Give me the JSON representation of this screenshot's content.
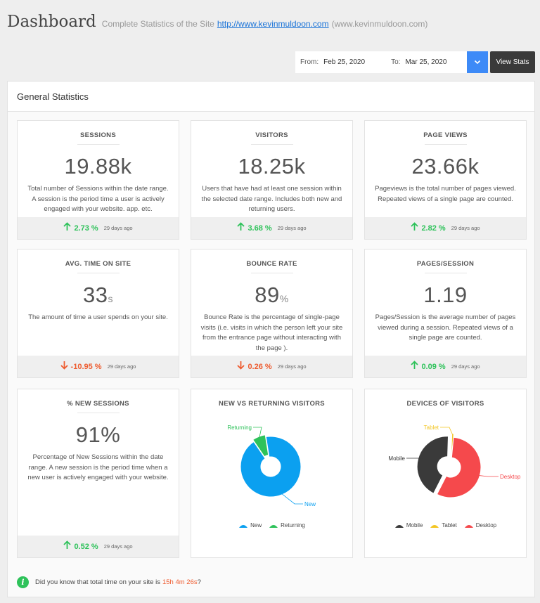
{
  "header": {
    "title": "Dashboard",
    "subtitle": "Complete Statistics of the Site",
    "link": "http://www.kevinmuldoon.com",
    "domain": "(www.kevinmuldoon.com)"
  },
  "datebar": {
    "from_label": "From:",
    "from_value": "Feb 25, 2020",
    "to_label": "To:",
    "to_value": "Mar 25, 2020",
    "button": "View Stats"
  },
  "panel": {
    "title": "General Statistics"
  },
  "colors": {
    "up": "#2ec25a",
    "down": "#ee5c30",
    "new": "#0ba0f0",
    "returning": "#2ec25a",
    "mobile": "#3a3a3a",
    "tablet": "#f3c623",
    "desktop": "#f5494c"
  },
  "cards": [
    {
      "title": "SESSIONS",
      "value": "19.88k",
      "description": "Total number of Sessions within the date range. A session is the period time a user is actively engaged with your website. app. etc.",
      "change": "2.73 %",
      "arrow": "↑",
      "ago": "29 days ago"
    },
    {
      "title": "VISITORS",
      "value": "18.25k",
      "description": "Users that have had at least one session within the selected date range. Includes both new and returning users.",
      "change": "3.68 %",
      "arrow": "↑",
      "ago": "29 days ago"
    },
    {
      "title": "PAGE VIEWS",
      "value": "23.66k",
      "description": "Pageviews is the total number of pages viewed. Repeated views of a single page are counted.",
      "change": "2.82 %",
      "arrow": "↑",
      "ago": "29 days ago"
    },
    {
      "title": "AVG. TIME ON SITE",
      "value": "33",
      "unit": "s",
      "description": "The amount of time a user spends on your site.",
      "change": "-10.95 %",
      "arrow": "↓",
      "ago": "29 days ago"
    },
    {
      "title": "BOUNCE RATE",
      "value": "89",
      "unit": "%",
      "description": "Bounce Rate is the percentage of single-page visits (i.e. visits in which the person left your site from the entrance page without interacting with the page ).",
      "change": "0.26 %",
      "arrow": "↓",
      "ago": "29 days ago"
    },
    {
      "title": "PAGES/SESSION",
      "value": "1.19",
      "description": "Pages/Session is the average number of pages viewed during a session. Repeated views of a single page are counted.",
      "change": "0.09 %",
      "arrow": "↑",
      "ago": "29 days ago"
    },
    {
      "title": "% NEW SESSIONS",
      "value": "91%",
      "description": "Percentage of New Sessions within the date range. A new session is the period time when a new user is actively engaged with your website.",
      "change": "0.52 %",
      "arrow": "↑",
      "ago": "29 days ago"
    }
  ],
  "chart_data": [
    {
      "type": "pie",
      "title": "NEW VS RETURNING VISITORS",
      "categories": [
        "New",
        "Returning"
      ],
      "values": [
        93,
        7
      ],
      "legend": "bottom"
    },
    {
      "type": "pie",
      "title": "DEVICES OF VISITORS",
      "categories": [
        "Mobile",
        "Tablet",
        "Desktop"
      ],
      "values": [
        43,
        1,
        56
      ],
      "legend": "bottom"
    }
  ],
  "tip": {
    "icon": "i",
    "text": "Did you know that total time on your site is",
    "highlight": "15h 4m 26s",
    "end": "?"
  }
}
